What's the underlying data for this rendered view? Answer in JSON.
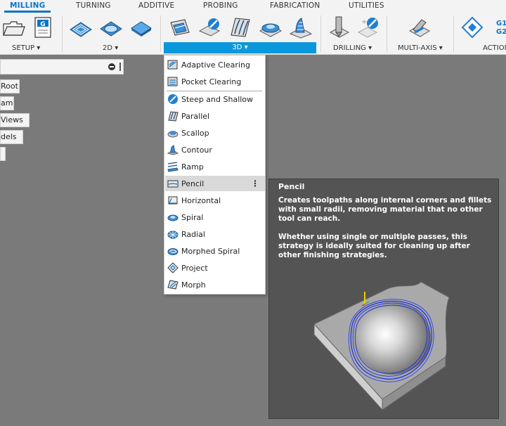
{
  "tabs": [
    {
      "label": "MILLING",
      "active": true
    },
    {
      "label": "TURNING"
    },
    {
      "label": "ADDITIVE"
    },
    {
      "label": "PROBING"
    },
    {
      "label": "FABRICATION"
    },
    {
      "label": "UTILITIES"
    }
  ],
  "groups": {
    "setup": "SETUP ▾",
    "twod": "2D ▾",
    "threed": "3D ▾",
    "drilling": "DRILLING ▾",
    "multiaxis": "MULTI-AXIS ▾",
    "actions": "ACTION"
  },
  "nc_icon_text": {
    "g": "G",
    "g1": "G1",
    "g2": "G2"
  },
  "browser": {
    "nodes": [
      "Root",
      "am",
      "Views",
      "dels",
      ""
    ]
  },
  "menu": {
    "items": [
      {
        "label": "Adaptive Clearing",
        "icon": "adaptive-clearing-icon"
      },
      {
        "label": "Pocket Clearing",
        "icon": "pocket-clearing-icon"
      },
      {
        "label": "Steep and Shallow",
        "icon": "steep-shallow-icon"
      },
      {
        "label": "Parallel",
        "icon": "parallel-icon"
      },
      {
        "label": "Scallop",
        "icon": "scallop-icon"
      },
      {
        "label": "Contour",
        "icon": "contour-icon"
      },
      {
        "label": "Ramp",
        "icon": "ramp-icon"
      },
      {
        "label": "Pencil",
        "icon": "pencil-icon",
        "highlighted": true
      },
      {
        "label": "Horizontal",
        "icon": "horizontal-icon"
      },
      {
        "label": "Spiral",
        "icon": "spiral-icon"
      },
      {
        "label": "Radial",
        "icon": "radial-icon"
      },
      {
        "label": "Morphed Spiral",
        "icon": "morphed-spiral-icon"
      },
      {
        "label": "Project",
        "icon": "project-icon"
      },
      {
        "label": "Morph",
        "icon": "morph-icon"
      }
    ],
    "more_glyph": "⋮"
  },
  "tooltip": {
    "title": "Pencil",
    "paragraph1": "Creates toolpaths along internal corners and fillets with small radii, removing material that no other tool can reach.",
    "paragraph2": "Whether using single or multiple passes, this strategy is ideally suited for cleaning up after other finishing strategies."
  },
  "colors": {
    "accent": "#0a74c4",
    "selected_group": "#0a97dc",
    "tooltip_bg": "#545454",
    "canvas": "#7a7a7a"
  }
}
